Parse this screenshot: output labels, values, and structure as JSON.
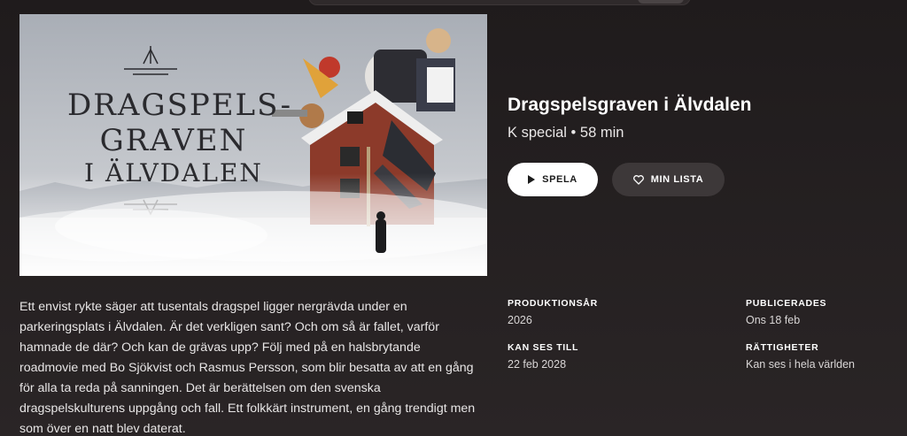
{
  "header": {
    "search_placeholder": ""
  },
  "hero": {
    "title_lines": [
      "DRAGSPELS-",
      "GRAVEN",
      "I ÄLVDALEN"
    ]
  },
  "program": {
    "title": "Dragspelsgraven i Älvdalen",
    "subtitle": "K special • 58 min"
  },
  "actions": {
    "play_label": "SPELA",
    "list_label": "MIN LISTA"
  },
  "description": "Ett envist rykte säger att tusentals dragspel ligger nergrävda under en parkeringsplats i Älvdalen. Är det verkligen sant? Och om så är fallet, varför hamnade de där? Och kan de grävas upp? Följ med på en halsbrytande roadmovie med Bo Sjökvist och Rasmus Persson, som blir besatta av att en gång för alla ta reda på sanningen. Det är berättelsen om den svenska dragspelskulturens uppgång och fall. Ett folkkärt instrument, en gång trendigt men som över en natt blev daterat.",
  "details": {
    "production_year_label": "PRODUKTIONSÅR",
    "production_year": "2026",
    "published_label": "PUBLICERADES",
    "published": "Ons 18 feb",
    "available_until_label": "KAN SES TILL",
    "available_until": "22 feb 2028",
    "rights_label": "RÄTTIGHETER",
    "rights": "Kan ses i hela världen"
  },
  "colors": {
    "background": "#242021",
    "play_button": "#ffffff",
    "list_button": "#3d3839"
  },
  "icons": {
    "play": "play-icon",
    "list": "heart-icon"
  }
}
